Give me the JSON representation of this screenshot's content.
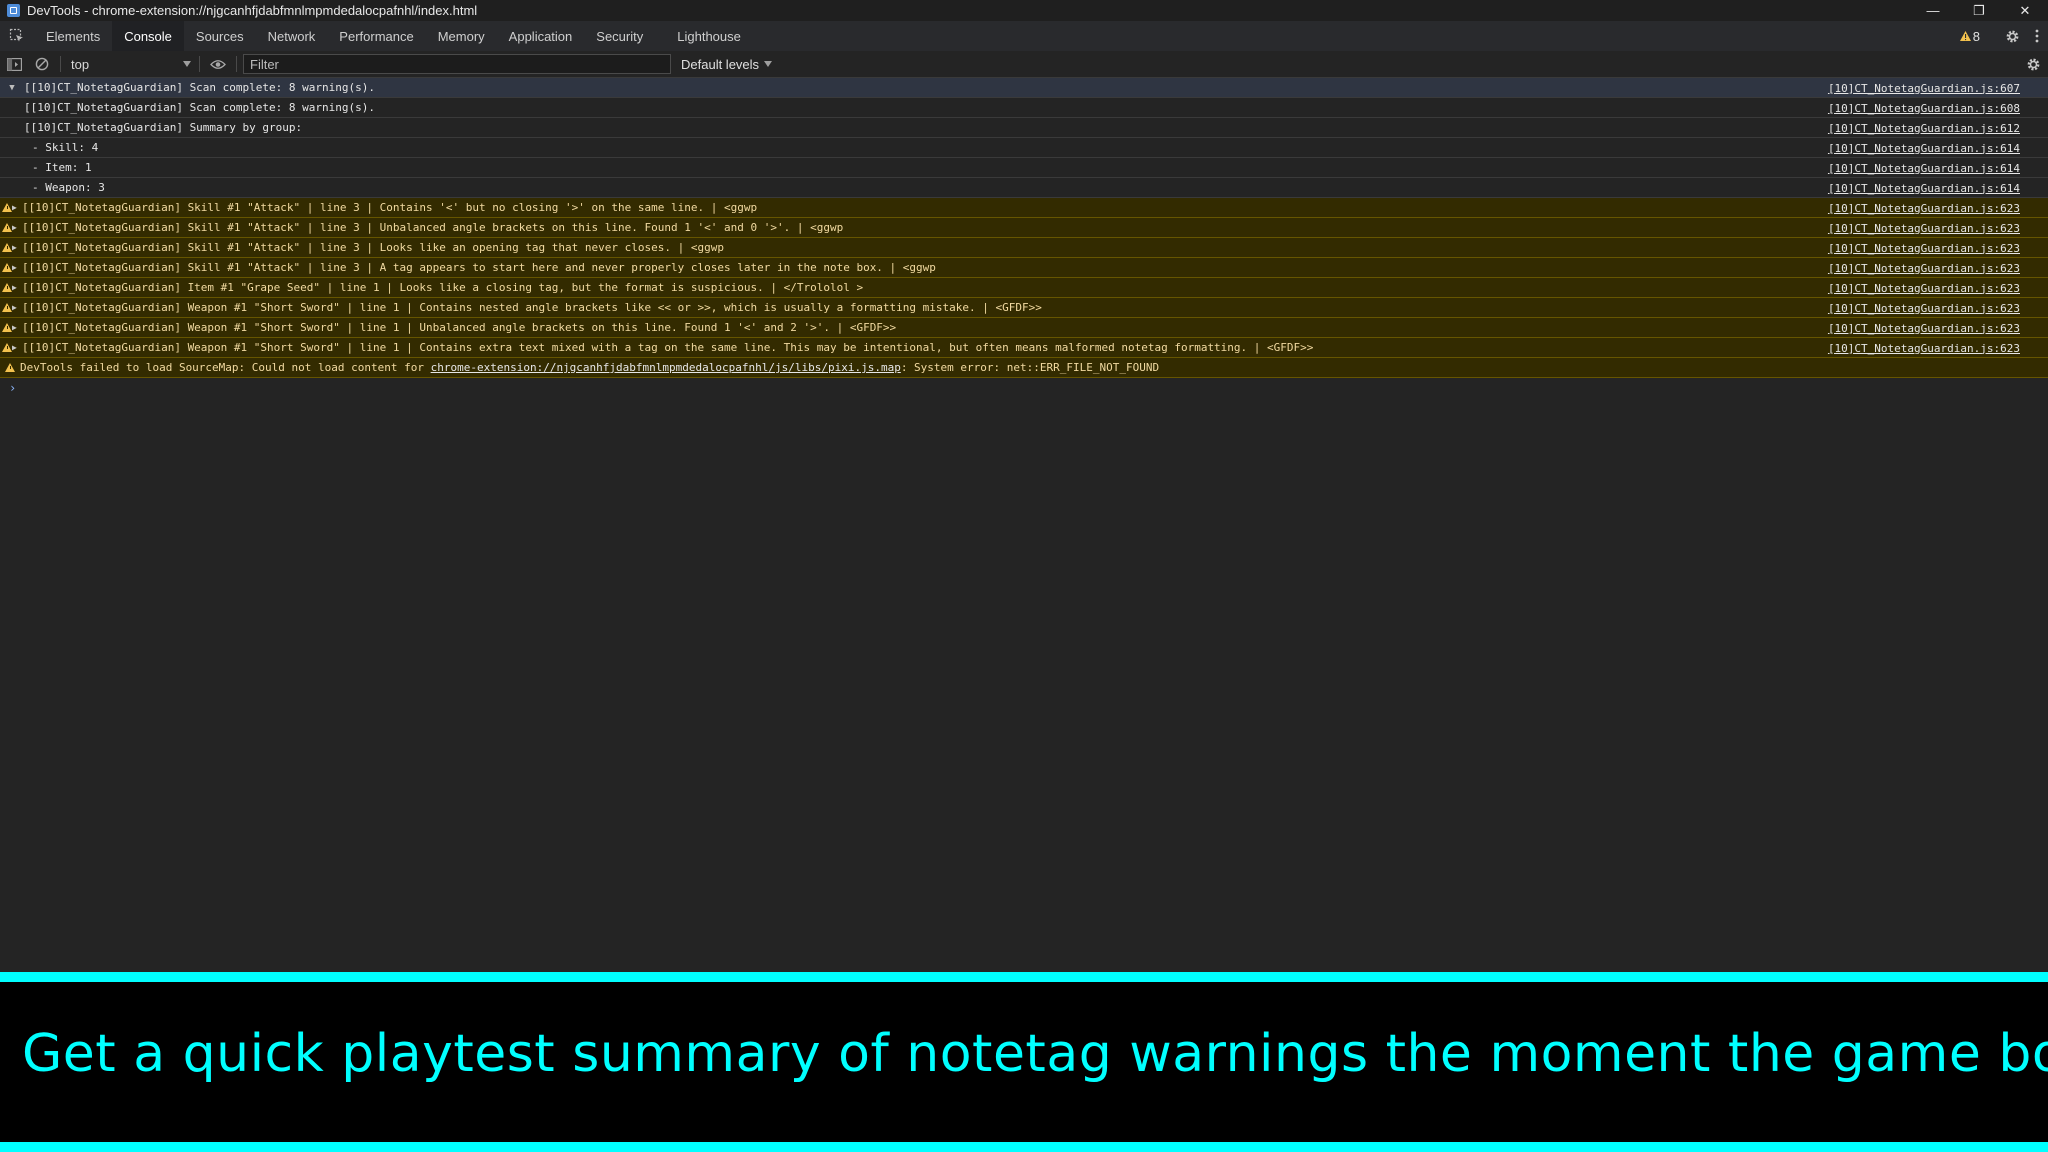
{
  "window": {
    "title": "DevTools - chrome-extension://njgcanhfjdabfmnlmpmdedalocpafnhl/index.html",
    "minimize_symbol": "—",
    "restore_symbol": "❐",
    "close_symbol": "✕"
  },
  "tabs": [
    {
      "label": "Elements"
    },
    {
      "label": "Console"
    },
    {
      "label": "Sources"
    },
    {
      "label": "Network"
    },
    {
      "label": "Performance"
    },
    {
      "label": "Memory"
    },
    {
      "label": "Application"
    },
    {
      "label": "Security"
    },
    {
      "label": "Lighthouse"
    }
  ],
  "active_tab": "Console",
  "issues": {
    "warning_count": "8"
  },
  "toolbar": {
    "context": "top",
    "filter_placeholder": "Filter",
    "levels": "Default levels"
  },
  "console_rows": [
    {
      "kind": "group",
      "text": "[[10]CT_NotetagGuardian] Scan complete: 8 warning(s).",
      "source": "[10]CT_NotetagGuardian.js:607"
    },
    {
      "kind": "log",
      "text": "[[10]CT_NotetagGuardian] Scan complete: 8 warning(s).",
      "source": "[10]CT_NotetagGuardian.js:608"
    },
    {
      "kind": "log",
      "text": "[[10]CT_NotetagGuardian] Summary by group:",
      "source": "[10]CT_NotetagGuardian.js:612"
    },
    {
      "kind": "log",
      "text": "- Skill: 4",
      "source": "[10]CT_NotetagGuardian.js:614"
    },
    {
      "kind": "log",
      "text": "- Item: 1",
      "source": "[10]CT_NotetagGuardian.js:614"
    },
    {
      "kind": "log",
      "text": "- Weapon: 3",
      "source": "[10]CT_NotetagGuardian.js:614"
    },
    {
      "kind": "warning",
      "text": "[[10]CT_NotetagGuardian] Skill #1 \"Attack\" | line 3 | Contains '<' but no closing '>' on the same line. | <ggwp",
      "source": "[10]CT_NotetagGuardian.js:623"
    },
    {
      "kind": "warning",
      "text": "[[10]CT_NotetagGuardian] Skill #1 \"Attack\" | line 3 | Unbalanced angle brackets on this line. Found 1 '<' and 0 '>'. | <ggwp",
      "source": "[10]CT_NotetagGuardian.js:623"
    },
    {
      "kind": "warning",
      "text": "[[10]CT_NotetagGuardian] Skill #1 \"Attack\" | line 3 | Looks like an opening tag that never closes. | <ggwp",
      "source": "[10]CT_NotetagGuardian.js:623"
    },
    {
      "kind": "warning",
      "text": "[[10]CT_NotetagGuardian] Skill #1 \"Attack\" | line 3 | A tag appears to start here and never properly closes later in the note box. | <ggwp",
      "source": "[10]CT_NotetagGuardian.js:623"
    },
    {
      "kind": "warning",
      "text": "[[10]CT_NotetagGuardian] Item #1 \"Grape Seed\" | line 1 | Looks like a closing tag, but the format is suspicious. | </Trololol >",
      "source": "[10]CT_NotetagGuardian.js:623"
    },
    {
      "kind": "warning",
      "text": "[[10]CT_NotetagGuardian] Weapon #1 \"Short Sword\" | line 1 | Contains nested angle brackets like << or >>, which is usually a formatting mistake. | <GFDF>>",
      "source": "[10]CT_NotetagGuardian.js:623"
    },
    {
      "kind": "warning",
      "text": "[[10]CT_NotetagGuardian] Weapon #1 \"Short Sword\" | line 1 | Unbalanced angle brackets on this line. Found 1 '<' and 2 '>'. | <GFDF>>",
      "source": "[10]CT_NotetagGuardian.js:623"
    },
    {
      "kind": "warning",
      "text": "[[10]CT_NotetagGuardian] Weapon #1 \"Short Sword\" | line 1 | Contains extra text mixed with a tag on the same line. This may be intentional, but often means malformed notetag formatting. | <GFDF>>",
      "source": "[10]CT_NotetagGuardian.js:623"
    }
  ],
  "sourcemap_warning": {
    "prefix": "DevTools failed to load SourceMap: Could not load content for ",
    "link": "chrome-extension://njgcanhfjdabfmnlmpmdedalocpafnhl/js/libs/pixi.js.map",
    "suffix": ": System error: net::ERR_FILE_NOT_FOUND"
  },
  "prompt_symbol": "›",
  "banner": {
    "caption": "Get a quick playtest summary of notetag warnings the moment the game boots"
  },
  "colors": {
    "accent": "#00ffff",
    "warning_bg": "#332b00",
    "warning_icon": "#f2c14e",
    "prompt": "#8ab4f8"
  }
}
